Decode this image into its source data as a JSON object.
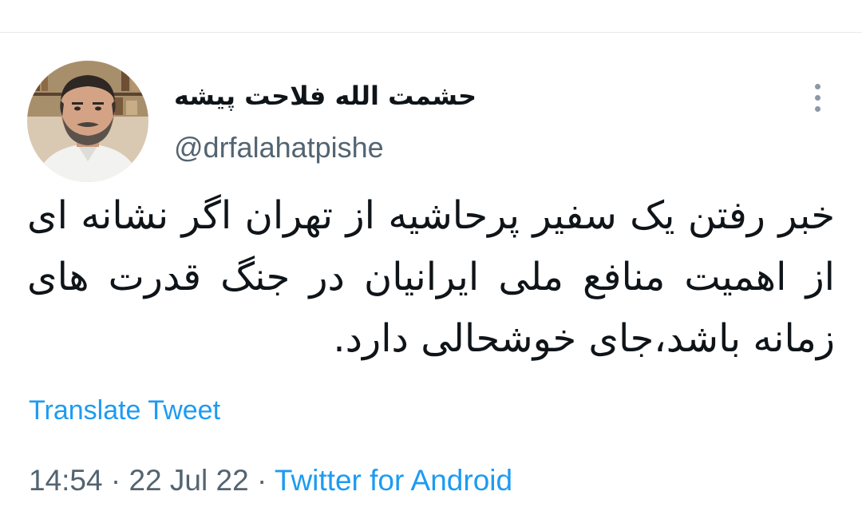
{
  "tweet": {
    "author": {
      "display_name": "حشمت الله فلاحت پیشه",
      "handle": "@drfalahatpishe",
      "avatar_icon": "profile-photo"
    },
    "more_icon": "more-vertical-icon",
    "text": "خبر رفتن یک سفیر پرحاشیه از تهران اگر نشانه ای از اهمیت منافع ملی ایرانیان در جنگ قدرت های زمانه باشد،جای خوشحالی دارد.",
    "translate_label": "Translate Tweet",
    "time": "14:54",
    "separator": "·",
    "date": "22 Jul 22",
    "source": "Twitter for Android"
  },
  "colors": {
    "text_primary": "#0f1419",
    "text_secondary": "#536471",
    "link": "#1d9bf0",
    "divider": "#e6e9ea"
  }
}
